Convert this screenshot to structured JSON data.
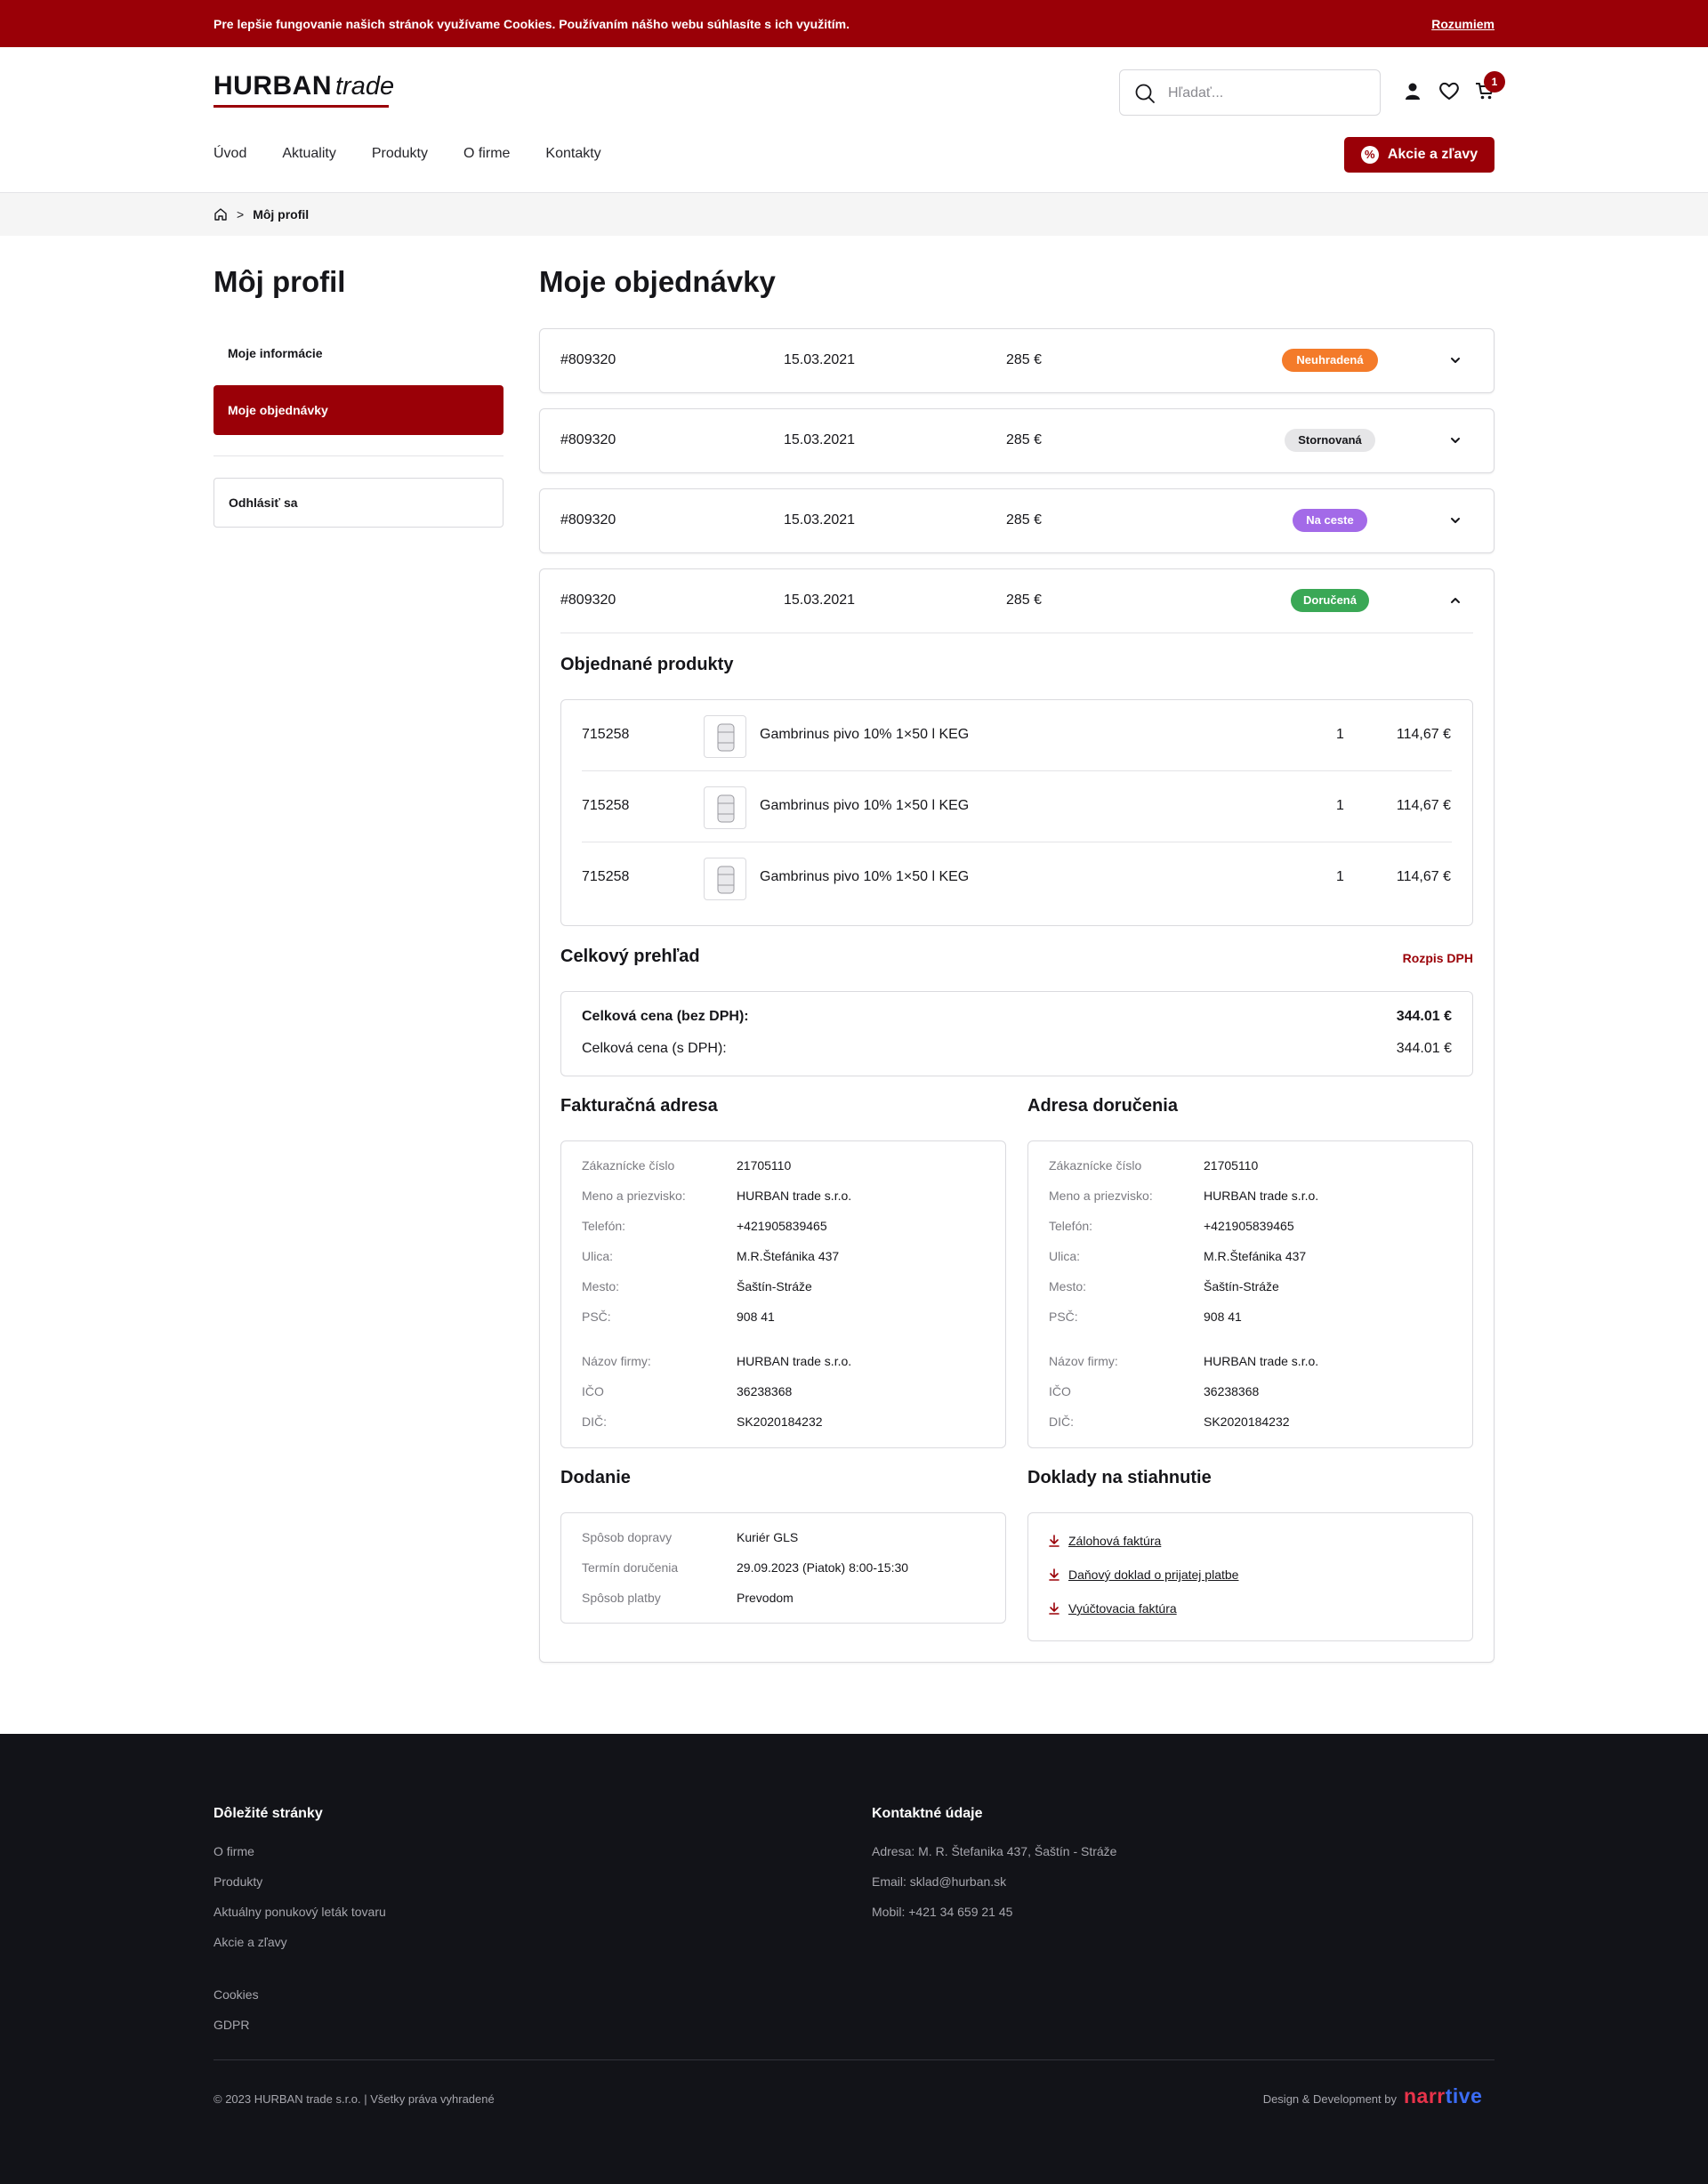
{
  "cookie_bar": {
    "text": "Pre lepšie fungovanie našich stránok využívame Cookies. Používaním nášho webu súhlasíte s ich využitím.",
    "accept": "Rozumiem"
  },
  "header": {
    "logo_brand": "HURBAN",
    "logo_suffix": "trade",
    "search_placeholder": "Hľadať...",
    "cart_count": "1",
    "nav": [
      "Úvod",
      "Aktuality",
      "Produkty",
      "O firme",
      "Kontakty"
    ],
    "promo_button": "Akcie a zľavy"
  },
  "breadcrumb": {
    "current": "Môj profil",
    "separator": ">"
  },
  "sidebar": {
    "title": "Môj profil",
    "items": [
      "Moje informácie",
      "Moje objednávky"
    ],
    "logout": "Odhlásiť sa"
  },
  "main": {
    "title": "Moje objednávky",
    "orders": [
      {
        "id": "#809320",
        "date": "15.03.2021",
        "total": "285 €",
        "status": "Neuhradená",
        "status_color": "#f47b2a",
        "status_text_color": "#ffffff"
      },
      {
        "id": "#809320",
        "date": "15.03.2021",
        "total": "285 €",
        "status": "Stornovaná",
        "status_color": "#e6e6e8",
        "status_text_color": "#16161a"
      },
      {
        "id": "#809320",
        "date": "15.03.2021",
        "total": "285 €",
        "status": "Na ceste",
        "status_color": "#a36ae8",
        "status_text_color": "#ffffff"
      },
      {
        "id": "#809320",
        "date": "15.03.2021",
        "total": "285 €",
        "status": "Doručená",
        "status_color": "#3aa856",
        "status_text_color": "#ffffff"
      }
    ],
    "detail": {
      "products_title": "Objednané produkty",
      "products": [
        {
          "code": "715258",
          "name": "Gambrinus pivo 10% 1×50 l KEG",
          "qty": "1",
          "price": "114,67 €"
        },
        {
          "code": "715258",
          "name": "Gambrinus pivo 10% 1×50 l KEG",
          "qty": "1",
          "price": "114,67 €"
        },
        {
          "code": "715258",
          "name": "Gambrinus pivo 10% 1×50 l KEG",
          "qty": "1",
          "price": "114,67 €"
        }
      ],
      "summary_title": "Celkový prehľad",
      "vat_link": "Rozpis DPH",
      "total_excl_label": "Celková cena (bez DPH):",
      "total_excl_value": "344.01 €",
      "total_incl_label": "Celková cena (s DPH):",
      "total_incl_value": "344.01 €",
      "billing": {
        "title": "Fakturačná adresa",
        "rows": [
          {
            "k": "Zákaznícke číslo",
            "v": "21705110"
          },
          {
            "k": "Meno a priezvisko:",
            "v": "HURBAN trade s.r.o."
          },
          {
            "k": "Telefón:",
            "v": "+421905839465"
          },
          {
            "k": "Ulica:",
            "v": "M.R.Štefánika 437"
          },
          {
            "k": "Mesto:",
            "v": "Šaštín-Stráže"
          },
          {
            "k": "PSČ:",
            "v": "908 41"
          },
          {
            "k": "Názov firmy:",
            "v": "HURBAN trade s.r.o."
          },
          {
            "k": "IČO",
            "v": "36238368"
          },
          {
            "k": "DIČ:",
            "v": "SK2020184232"
          }
        ]
      },
      "shipping": {
        "title": "Adresa doručenia",
        "rows": [
          {
            "k": "Zákaznícke číslo",
            "v": "21705110"
          },
          {
            "k": "Meno a priezvisko:",
            "v": "HURBAN trade s.r.o."
          },
          {
            "k": "Telefón:",
            "v": "+421905839465"
          },
          {
            "k": "Ulica:",
            "v": "M.R.Štefánika 437"
          },
          {
            "k": "Mesto:",
            "v": "Šaštín-Stráže"
          },
          {
            "k": "PSČ:",
            "v": "908 41"
          },
          {
            "k": "Názov firmy:",
            "v": "HURBAN trade s.r.o."
          },
          {
            "k": "IČO",
            "v": "36238368"
          },
          {
            "k": "DIČ:",
            "v": "SK2020184232"
          }
        ]
      },
      "delivery": {
        "title": "Dodanie",
        "rows": [
          {
            "k": "Spôsob dopravy",
            "v": "Kuriér GLS"
          },
          {
            "k": "Termín doručenia",
            "v": "29.09.2023 (Piatok) 8:00-15:30"
          },
          {
            "k": "Spôsob platby",
            "v": "Prevodom"
          }
        ]
      },
      "documents": {
        "title": "Doklady na stiahnutie",
        "items": [
          "Zálohová faktúra",
          "Daňový doklad o prijatej platbe",
          "Vyúčtovacia faktúra"
        ]
      }
    }
  },
  "footer": {
    "col1_title": "Dôležité stránky",
    "col1_links": [
      "O firme",
      "Produkty",
      "Aktuálny ponukový leták tovaru",
      "Akcie a zľavy"
    ],
    "col1_links2": [
      "Cookies",
      "GDPR"
    ],
    "col2_title": "Kontaktné údaje",
    "col2_lines": [
      "Adresa: M. R. Štefanika 437, Šaštín - Stráže",
      "Email: sklad@hurban.sk",
      "Mobil: +421 34 659 21 45"
    ],
    "copyright": "© 2023 HURBAN trade s.r.o. | Všetky práva vyhradené",
    "dev_label": "Design & Development by",
    "dev_logo_a": "narr",
    "dev_logo_b": "tive"
  },
  "colors": {
    "brand_red": "#9a0007",
    "footer_bg": "#121318"
  }
}
